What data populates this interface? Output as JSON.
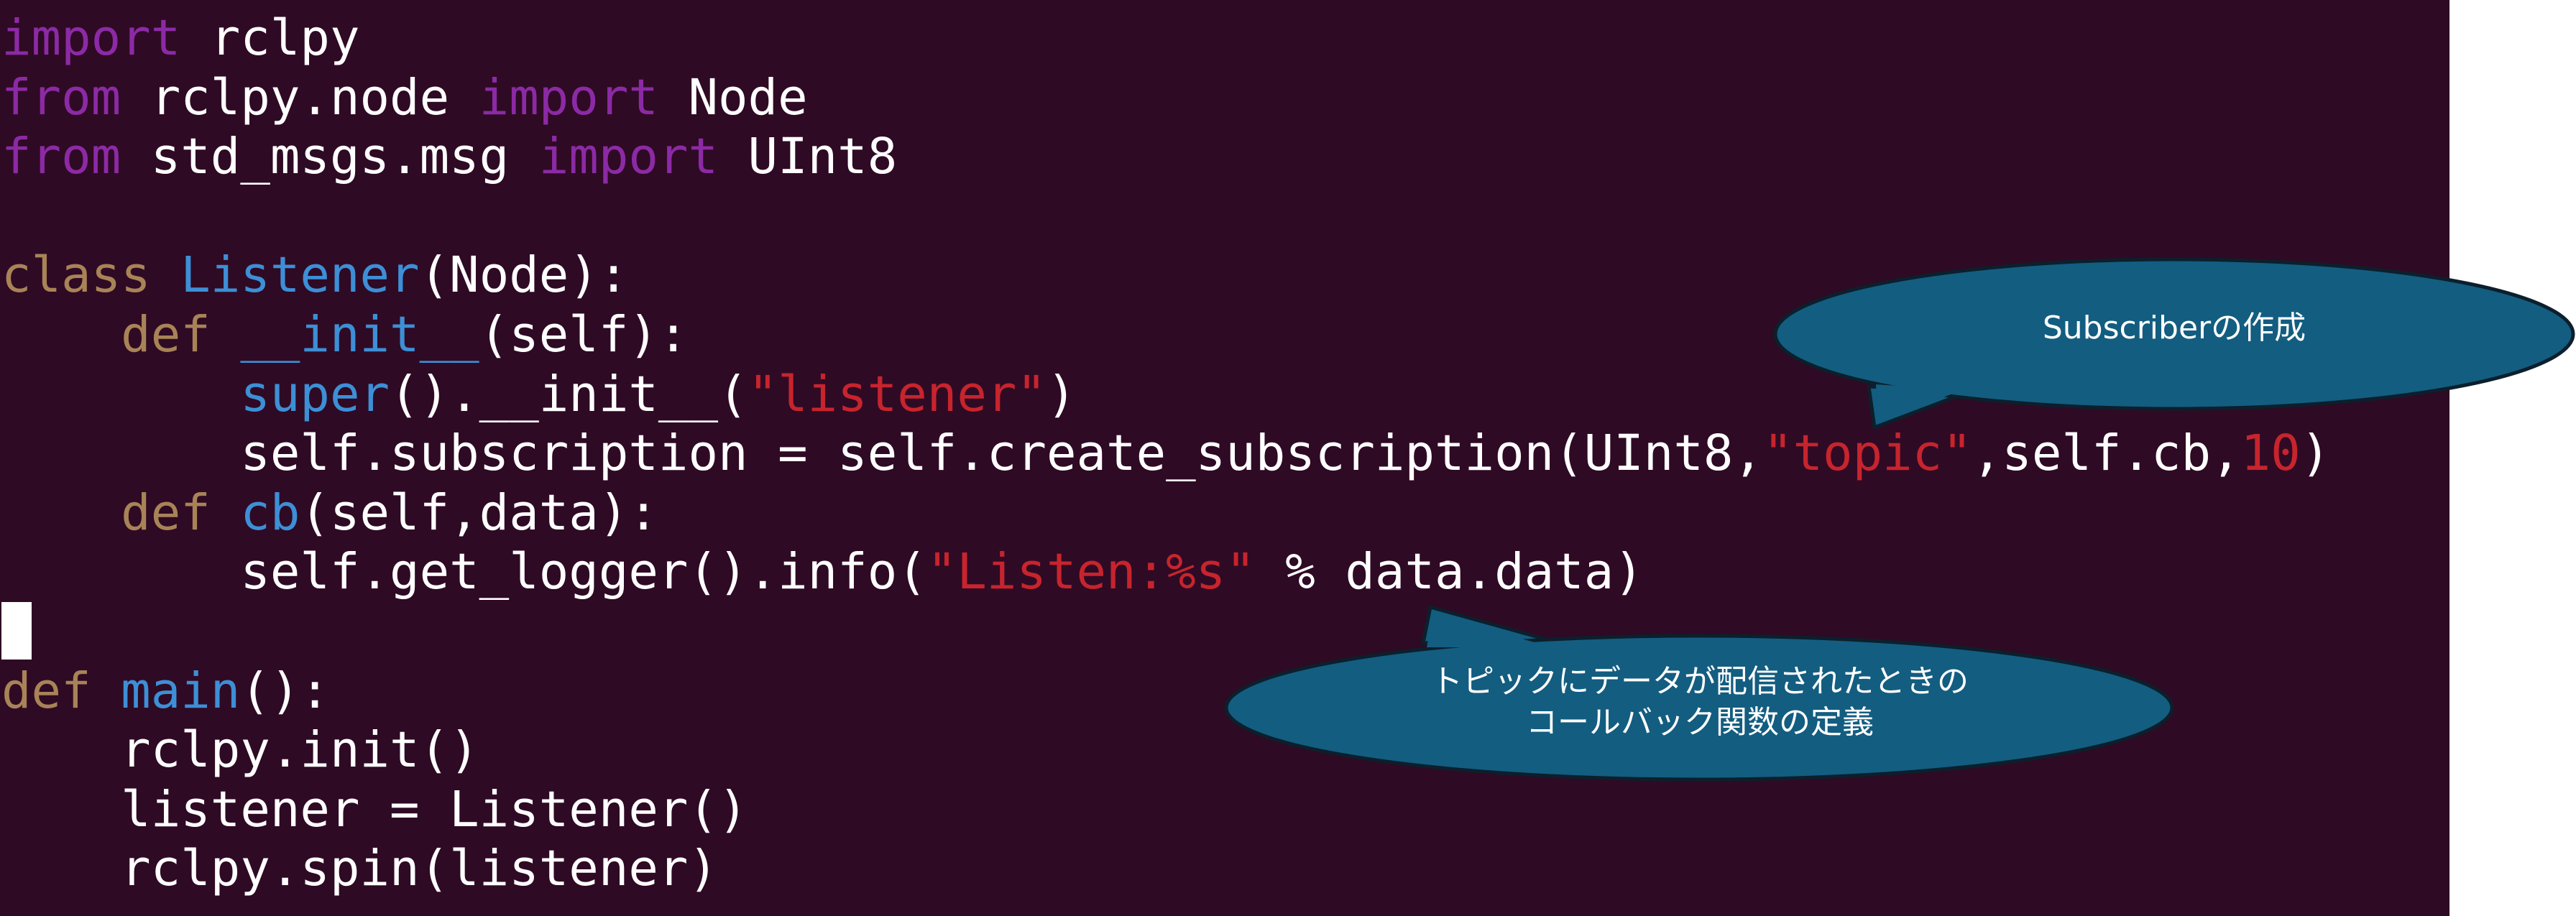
{
  "code": {
    "lines": [
      [
        {
          "t": "import",
          "c": "kw-purple"
        },
        {
          "t": " rclpy",
          "c": "plain"
        }
      ],
      [
        {
          "t": "from",
          "c": "kw-purple"
        },
        {
          "t": " rclpy.node ",
          "c": "plain"
        },
        {
          "t": "import",
          "c": "kw-purple"
        },
        {
          "t": " Node",
          "c": "plain"
        }
      ],
      [
        {
          "t": "from",
          "c": "kw-purple"
        },
        {
          "t": " std_msgs.msg ",
          "c": "plain"
        },
        {
          "t": "import",
          "c": "kw-purple"
        },
        {
          "t": " UInt8",
          "c": "plain"
        }
      ],
      [],
      [
        {
          "t": "class",
          "c": "kw-brown"
        },
        {
          "t": " ",
          "c": "plain"
        },
        {
          "t": "Listener",
          "c": "fn-blue"
        },
        {
          "t": "(Node):",
          "c": "plain"
        }
      ],
      [
        {
          "t": "    ",
          "c": "plain"
        },
        {
          "t": "def",
          "c": "kw-brown"
        },
        {
          "t": " ",
          "c": "plain"
        },
        {
          "t": "__init__",
          "c": "fn-blue"
        },
        {
          "t": "(self):",
          "c": "plain"
        }
      ],
      [
        {
          "t": "        ",
          "c": "plain"
        },
        {
          "t": "super",
          "c": "fn-blue"
        },
        {
          "t": "().__init__(",
          "c": "plain"
        },
        {
          "t": "\"listener\"",
          "c": "str-red"
        },
        {
          "t": ")",
          "c": "plain"
        }
      ],
      [
        {
          "t": "        self.subscription = self.create_subscription(UInt8,",
          "c": "plain"
        },
        {
          "t": "\"topic\"",
          "c": "str-red"
        },
        {
          "t": ",self.cb,",
          "c": "plain"
        },
        {
          "t": "10",
          "c": "num-red"
        },
        {
          "t": ")",
          "c": "plain"
        }
      ],
      [
        {
          "t": "    ",
          "c": "plain"
        },
        {
          "t": "def",
          "c": "kw-brown"
        },
        {
          "t": " ",
          "c": "plain"
        },
        {
          "t": "cb",
          "c": "fn-blue"
        },
        {
          "t": "(self,data):",
          "c": "plain"
        }
      ],
      [
        {
          "t": "        self.get_logger().info(",
          "c": "plain"
        },
        {
          "t": "\"Listen:%s\"",
          "c": "str-red"
        },
        {
          "t": " % data.data)",
          "c": "plain"
        }
      ],
      [
        {
          "t": "",
          "c": "cursor"
        }
      ],
      [
        {
          "t": "def",
          "c": "kw-brown"
        },
        {
          "t": " ",
          "c": "plain"
        },
        {
          "t": "main",
          "c": "fn-blue"
        },
        {
          "t": "():",
          "c": "plain"
        }
      ],
      [
        {
          "t": "    rclpy.init()",
          "c": "plain"
        }
      ],
      [
        {
          "t": "    listener = Listener()",
          "c": "plain"
        }
      ],
      [
        {
          "t": "    rclpy.spin(listener)",
          "c": "plain"
        }
      ]
    ]
  },
  "callouts": {
    "subscriber": {
      "label": "Subscriberの作成"
    },
    "callback": {
      "line1": "トピックにデータが配信されたときの",
      "line2": "コールバック関数の定義"
    }
  },
  "colors": {
    "terminal_bg": "#2f0a24",
    "callout_fill": "#135d80",
    "callout_stroke": "#0c1f2c"
  }
}
